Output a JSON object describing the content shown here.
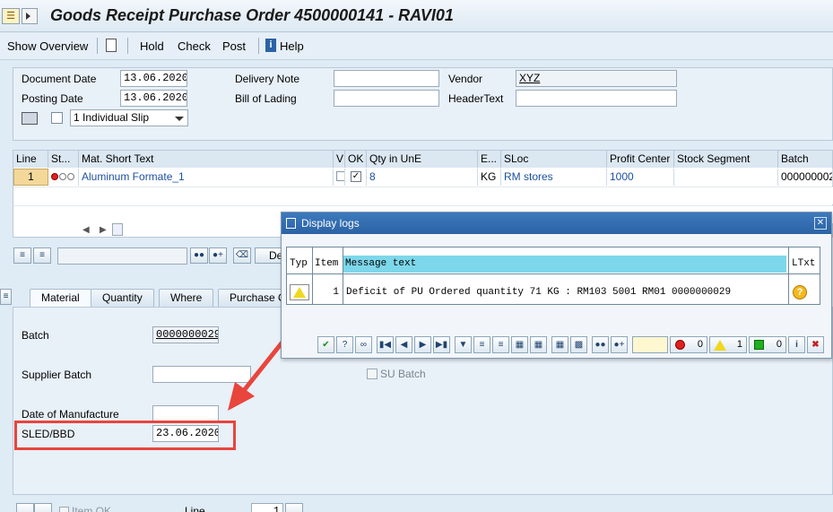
{
  "window": {
    "title": "Goods Receipt Purchase Order 4500000141 - RAVI01"
  },
  "toolbar": {
    "show_overview": "Show Overview",
    "hold": "Hold",
    "check": "Check",
    "post": "Post",
    "help": "Help"
  },
  "header": {
    "document_date_label": "Document Date",
    "document_date": "13.06.2020",
    "posting_date_label": "Posting Date",
    "posting_date": "13.06.2020",
    "delivery_note_label": "Delivery Note",
    "delivery_note": "",
    "bill_of_lading_label": "Bill of Lading",
    "bill_of_lading": "",
    "vendor_label": "Vendor",
    "vendor": "XYZ",
    "header_text_label": "HeaderText",
    "header_text": "",
    "slip_option": "1 Individual Slip"
  },
  "table": {
    "columns": [
      "Line",
      "St...",
      "Mat. Short Text",
      "V",
      "OK",
      "Qty in UnE",
      "E...",
      "SLoc",
      "Profit Center",
      "Stock Segment",
      "Batch"
    ],
    "rows": [
      {
        "line": "1",
        "material": "Aluminum Formate_1",
        "qty": "8",
        "unit": "KG",
        "sloc": "RM stores",
        "profit_center": "1000",
        "stock_segment": "",
        "batch": "000000002"
      }
    ]
  },
  "detail_toolbar": {
    "delete_label": "De"
  },
  "tabs": [
    "Material",
    "Quantity",
    "Where",
    "Purchase O"
  ],
  "detail": {
    "batch_label": "Batch",
    "batch": "0000000029",
    "supplier_batch_label": "Supplier Batch",
    "supplier_batch": "",
    "su_batch_label": "SU Batch",
    "dom_label": "Date of Manufacture",
    "dom": "",
    "sled_label": "SLED/BBD",
    "sled": "23.06.2020"
  },
  "footer": {
    "item_ok": "Item OK",
    "line_label": "Line",
    "line_value": "1"
  },
  "dialog": {
    "title": "Display logs",
    "columns": [
      "Typ",
      "Item",
      "Message text",
      "LTxt"
    ],
    "rows": [
      {
        "item": "1",
        "message": "Deficit of PU Ordered quantity 71 KG : RM103 5001 RM01 0000000029"
      }
    ],
    "counts": {
      "errors": "0",
      "warnings": "1",
      "success": "0"
    }
  },
  "colors": {
    "annotation_red": "#e8453c",
    "header_cyan": "#7dd7ea",
    "sap_blue": "#2b63a5"
  }
}
